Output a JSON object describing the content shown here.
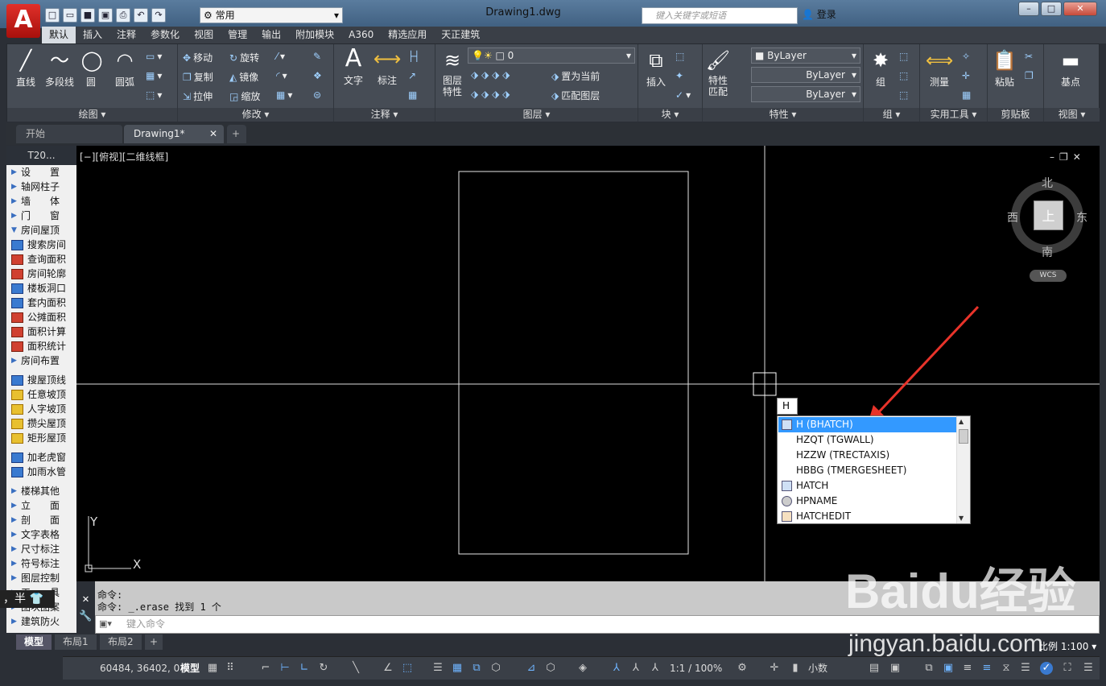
{
  "app": {
    "logo": "A",
    "workspace": "常用",
    "doc_title": "Drawing1.dwg",
    "search_placeholder": "键入关键字或短语",
    "login": "登录"
  },
  "ribbon_tabs": [
    "默认",
    "插入",
    "注释",
    "参数化",
    "视图",
    "管理",
    "输出",
    "附加模块",
    "A360",
    "精选应用",
    "天正建筑"
  ],
  "draw": {
    "line": "直线",
    "polyline": "多段线",
    "circle": "圆",
    "arc": "圆弧",
    "label": "绘图"
  },
  "modify": {
    "move": "移动",
    "rotate": "旋转",
    "copy": "复制",
    "mirror": "镜像",
    "stretch": "拉伸",
    "scale": "缩放",
    "label": "修改"
  },
  "annotation": {
    "text": "文字",
    "dim": "标注",
    "label": "注释"
  },
  "layers": {
    "props": "图层\n特性",
    "current": "0",
    "setcurrent": "置为当前",
    "match": "匹配图层",
    "label": "图层"
  },
  "block": {
    "insert": "插入",
    "label": "块"
  },
  "properties": {
    "match": "特性\n匹配",
    "color": "ByLayer",
    "linetype": "ByLayer",
    "lineweight": "ByLayer",
    "label": "特性"
  },
  "group": {
    "group": "组",
    "label": "组"
  },
  "utilities": {
    "measure": "测量",
    "label": "实用工具"
  },
  "clipboard": {
    "paste": "粘贴",
    "label": "剪贴板"
  },
  "view": {
    "base": "基点",
    "label": "视图"
  },
  "doc_tabs": {
    "start": "开始",
    "drawing": "Drawing1*"
  },
  "palette": {
    "title": "T20...",
    "items": [
      {
        "t": "设　　置",
        "k": "ar"
      },
      {
        "t": "轴网柱子",
        "k": "ar"
      },
      {
        "t": "墙　　体",
        "k": "ar"
      },
      {
        "t": "门　　窗",
        "k": "ar"
      },
      {
        "t": "房间屋顶",
        "k": "open"
      },
      {
        "t": "搜索房间",
        "k": "b"
      },
      {
        "t": "查询面积",
        "k": "r"
      },
      {
        "t": "房间轮廓",
        "k": "r"
      },
      {
        "t": "楼板洞口",
        "k": "b"
      },
      {
        "t": "套内面积",
        "k": "b"
      },
      {
        "t": "公摊面积",
        "k": "r"
      },
      {
        "t": "面积计算",
        "k": "r"
      },
      {
        "t": "面积统计",
        "k": "r"
      },
      {
        "t": "房间布置",
        "k": "ar"
      },
      {
        "t": "",
        "k": "sep"
      },
      {
        "t": "搜屋顶线",
        "k": "b"
      },
      {
        "t": "任意坡顶",
        "k": "y"
      },
      {
        "t": "人字坡顶",
        "k": "y"
      },
      {
        "t": "攒尖屋顶",
        "k": "y"
      },
      {
        "t": "矩形屋顶",
        "k": "y"
      },
      {
        "t": "",
        "k": "sep"
      },
      {
        "t": "加老虎窗",
        "k": "b"
      },
      {
        "t": "加雨水管",
        "k": "b"
      },
      {
        "t": "",
        "k": "sep"
      },
      {
        "t": "楼梯其他",
        "k": "ar"
      },
      {
        "t": "立　　面",
        "k": "ar"
      },
      {
        "t": "剖　　面",
        "k": "ar"
      },
      {
        "t": "文字表格",
        "k": "ar"
      },
      {
        "t": "尺寸标注",
        "k": "ar"
      },
      {
        "t": "符号标注",
        "k": "ar"
      },
      {
        "t": "图层控制",
        "k": "ar"
      },
      {
        "t": "工　　具",
        "k": "ar"
      },
      {
        "t": "图块图案",
        "k": "ar"
      },
      {
        "t": "建筑防火",
        "k": "ar"
      }
    ]
  },
  "ime_badge": "，半",
  "viewport_label": "[−][俯视][二维线框]",
  "viewcube": {
    "top": "上",
    "n": "北",
    "s": "南",
    "e": "东",
    "w": "西",
    "wcs": "WCS"
  },
  "ucs": {
    "x": "X",
    "y": "Y"
  },
  "command": {
    "history": [
      "命令:",
      "命令:  _.erase 找到 1 个"
    ],
    "placeholder": "键入命令"
  },
  "autocomplete": {
    "input": "H",
    "items": [
      "H (BHATCH)",
      "HZQT (TGWALL)",
      "HZZW (TRECTAXIS)",
      "HBBG (TMERGESHEET)",
      "HATCH",
      "HPNAME",
      "HATCHEDIT"
    ],
    "selected": 0
  },
  "layout_tabs": [
    "模型",
    "布局1",
    "布局2"
  ],
  "status": {
    "coords": "60484, 36402, 0",
    "model": "模型",
    "scale": "1:1 / 100%",
    "units": "小数",
    "ratio": "比例 1:100"
  },
  "watermark": {
    "logo": "Baidu经验",
    "url": "jingyan.baidu.com"
  }
}
